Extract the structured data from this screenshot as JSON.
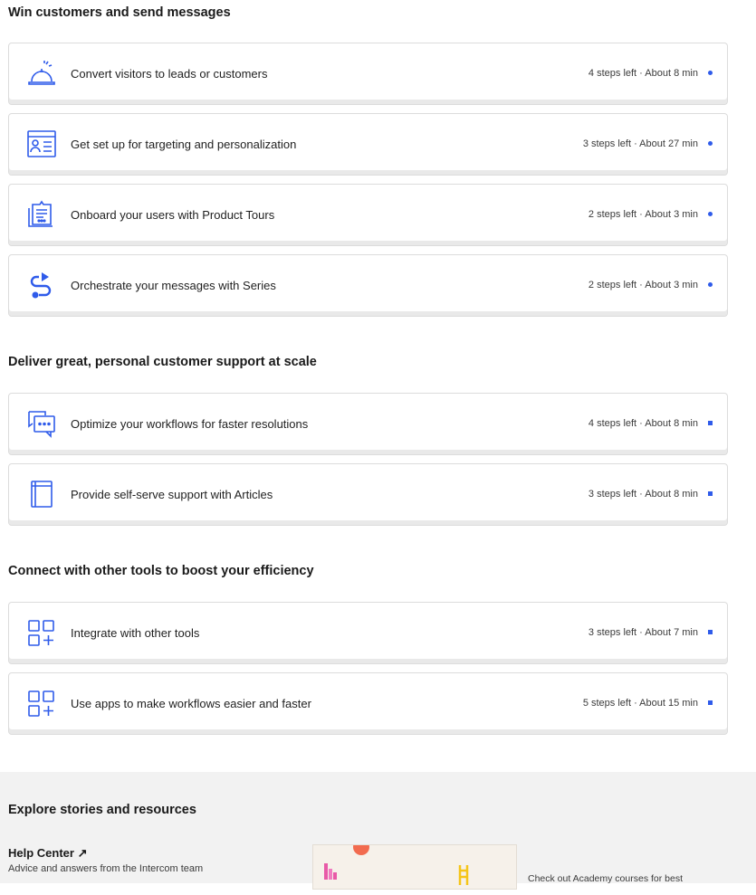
{
  "sections": [
    {
      "title": "Win customers and send messages",
      "items": [
        {
          "label": "Convert visitors to leads or customers",
          "meta": "4 steps left · About 8 min",
          "icon": "bell-icon"
        },
        {
          "label": "Get set up for targeting and personalization",
          "meta": "3 steps left · About 27 min",
          "icon": "profile-card-icon"
        },
        {
          "label": "Onboard your users with Product Tours",
          "meta": "2 steps left · About 3 min",
          "icon": "tour-icon"
        },
        {
          "label": "Orchestrate your messages with Series",
          "meta": "2 steps left · About 3 min",
          "icon": "series-icon"
        }
      ]
    },
    {
      "title": "Deliver great, personal customer support at scale",
      "items": [
        {
          "label": "Optimize your workflows for faster resolutions",
          "meta": "4 steps left · About 8 min",
          "icon": "chat-icon"
        },
        {
          "label": "Provide self-serve support with Articles",
          "meta": "3 steps left · About 8 min",
          "icon": "book-icon"
        }
      ]
    },
    {
      "title": "Connect with other tools to boost your efficiency",
      "items": [
        {
          "label": "Integrate with other tools",
          "meta": "3 steps left · About 7 min",
          "icon": "apps-grid-icon"
        },
        {
          "label": "Use apps to make workflows easier and faster",
          "meta": "5 steps left · About 15 min",
          "icon": "apps-grid-icon"
        }
      ]
    }
  ],
  "footer": {
    "title": "Explore stories and resources",
    "help_center": "Help Center ↗",
    "help_desc": "Advice and answers from the Intercom team",
    "promo_text": "Check out Academy courses for best"
  },
  "colors": {
    "accent": "#2f5bea",
    "footer_bg": "#f2f2f2"
  }
}
